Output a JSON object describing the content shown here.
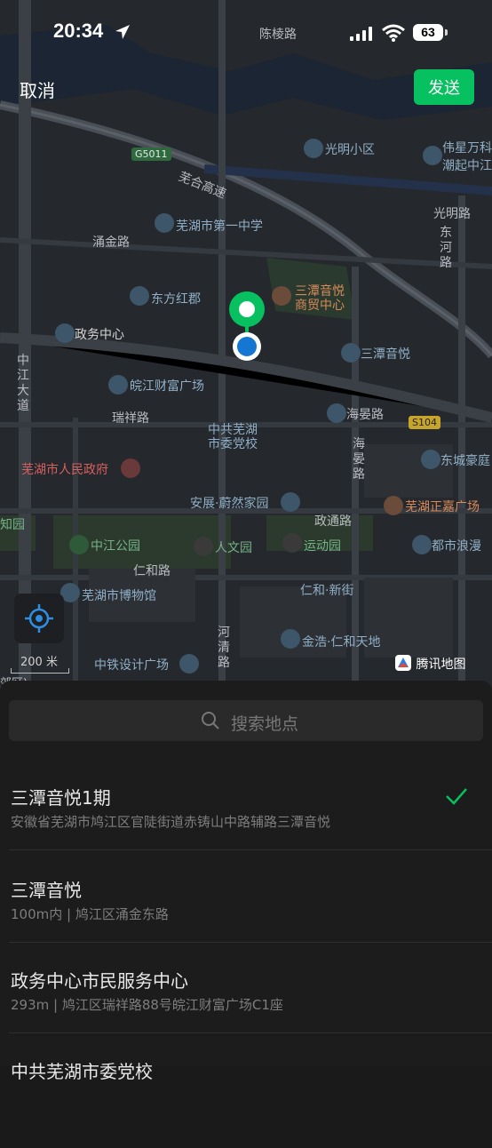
{
  "status_bar": {
    "time": "20:34",
    "battery": "63"
  },
  "nav": {
    "cancel_label": "取消",
    "send_label": "发送"
  },
  "map": {
    "roads": {
      "chenling": "陈棱路",
      "wuhu_hs": "芜合高速",
      "guangming": "光明路",
      "dongheluo": "东河路",
      "yongjin": "涌金路",
      "zhongjiang": "中江大道",
      "ruixiang": "瑞祥路",
      "haiyan": "海晏路",
      "haiyan_v": "海晏路",
      "zhengtong": "政通路",
      "renhe": "仁和路",
      "heqing": "河清路"
    },
    "pois": {
      "guangming_xq": "光明小区",
      "weixing": "伟星万科",
      "chaoqi": "潮起中江",
      "no1_school": "芜湖市第一中学",
      "dongfanghong": "东方红郡",
      "santan_mall": "三潭音悦\n商贸中心",
      "zhengwu": "政务中心",
      "santan": "三潭音悦",
      "wanjiang": "皖江财富广场",
      "party_school": "中共芜湖\n市委党校",
      "gov": "芜湖市人民政府",
      "dongcheng": "东城豪庭",
      "anzhan": "安展·蔚然家园",
      "zhengjia": "芜湖正嘉广场",
      "zhiyuan": "知园",
      "zhongjiang_park": "中江公园",
      "renwen": "人文园",
      "yundong": "运动园",
      "dushi": "都市浪漫",
      "museum": "芜湖市博物馆",
      "renhe_st": "仁和·新街",
      "jinhao": "金浩·仁和天地",
      "zhongtie": "中铁设计广场",
      "jiaoqu": "郊区)"
    },
    "shields": {
      "g5011": "G5011",
      "s104": "S104"
    },
    "scale_label": "200 米",
    "brand_label": "腾讯地图"
  },
  "search": {
    "placeholder": "搜索地点"
  },
  "results": [
    {
      "title": "三潭音悦1期",
      "subtitle": "安徽省芜湖市鸠江区官陡街道赤铸山中路辅路三潭音悦"
    },
    {
      "title": "三潭音悦",
      "subtitle": "100m内 | 鸠江区涌金东路"
    },
    {
      "title": "政务中心市民服务中心",
      "subtitle": "293m | 鸠江区瑞祥路88号皖江财富广场C1座"
    },
    {
      "title": "中共芜湖市委党校",
      "subtitle": ""
    }
  ],
  "colors": {
    "accent": "#07c160",
    "pin_blue": "#1677d2",
    "background": "#1c1c1c"
  }
}
